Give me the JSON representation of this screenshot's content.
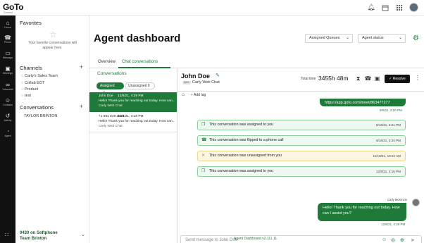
{
  "app": {
    "logo": "GoTo",
    "logo_sub": "Connect",
    "version": "Agent Dashboard v2.111.11"
  },
  "topbar": {
    "icons": [
      "bell-icon",
      "calendar-icon",
      "apps-grid-icon"
    ]
  },
  "nav": {
    "items": [
      {
        "label": "Home",
        "icon": "home-icon"
      },
      {
        "label": "Phone",
        "icon": "phone-icon"
      },
      {
        "label": "Message",
        "icon": "message-icon"
      },
      {
        "label": "Meetings",
        "icon": "video-icon"
      },
      {
        "label": "Voicemail",
        "icon": "voicemail-icon"
      },
      {
        "label": "Contacts",
        "icon": "contacts-icon"
      },
      {
        "label": "Activity",
        "icon": "history-icon"
      },
      {
        "label": "Agent",
        "icon": "agent-icon"
      }
    ]
  },
  "sidebar": {
    "favorites_title": "Favorites",
    "favorites_empty": "Your favorite conversations will appear here.",
    "channels_title": "Channels",
    "channels": [
      "Carly's Sales Team",
      "Collab EOT",
      "Product",
      "test"
    ],
    "conversations_title": "Conversations",
    "conversations": [
      "TAYLOR BRINTON"
    ],
    "softphone_line1": "0430 on Softphone",
    "softphone_line2": "Team Brinton"
  },
  "header": {
    "title": "Agent dashboard",
    "queues_label": "Assigned Queues",
    "status_label": "Agent status"
  },
  "tabs": [
    {
      "label": "Overview"
    },
    {
      "label": "Chat conversations"
    }
  ],
  "conversations_panel": {
    "title": "Conversations",
    "assigned_label": "Assigned",
    "assigned_count": "2",
    "unassigned_label": "Unassigned",
    "unassigned_count": "0",
    "items": [
      {
        "name": "John Doe",
        "time": "12/8/21, 4:29 PM",
        "preview": "Hello! Thank you for reaching out today. How can...",
        "channel": "Carly Web Chat"
      },
      {
        "name": "+1 661 549 2814",
        "time": "12/8/21, 4:18 PM",
        "preview": "Hello! Thank you for reaching out today. How can...",
        "channel": "Carly Web Chat"
      }
    ]
  },
  "chat": {
    "contact_name": "John Doe",
    "badge": "SMS",
    "channel": "Carly Web Chat",
    "total_time_label": "Total time",
    "total_time": "3455h 48m",
    "resolve_label": "Resolve",
    "add_tag_label": "Add tag",
    "top_message": "https://app.goto.com/meet/863477277",
    "top_message_time": "9/6/21, 2:20 PM",
    "events": [
      {
        "text": "This conversation was assigned to you",
        "time": "8/16/21, 2:21 PM",
        "kind": "info"
      },
      {
        "text": "This conversation was flipped to a phone call",
        "time": "8/16/21, 2:24 PM",
        "kind": "info"
      },
      {
        "text": "This conversation was unassigned from you",
        "time": "11/10/21, 10:22 AM",
        "kind": "warn"
      },
      {
        "text": "This conversation was assigned to you",
        "time": "12/8/21, 4:15 PM",
        "kind": "info"
      }
    ],
    "sender": "Carly McKinzie",
    "last_message": "Hello!  Thank you for reaching out today.  How can I assist you?",
    "last_message_time": "12/8/21, 4:29 PM",
    "composer_placeholder": "Send message to John Doe"
  }
}
